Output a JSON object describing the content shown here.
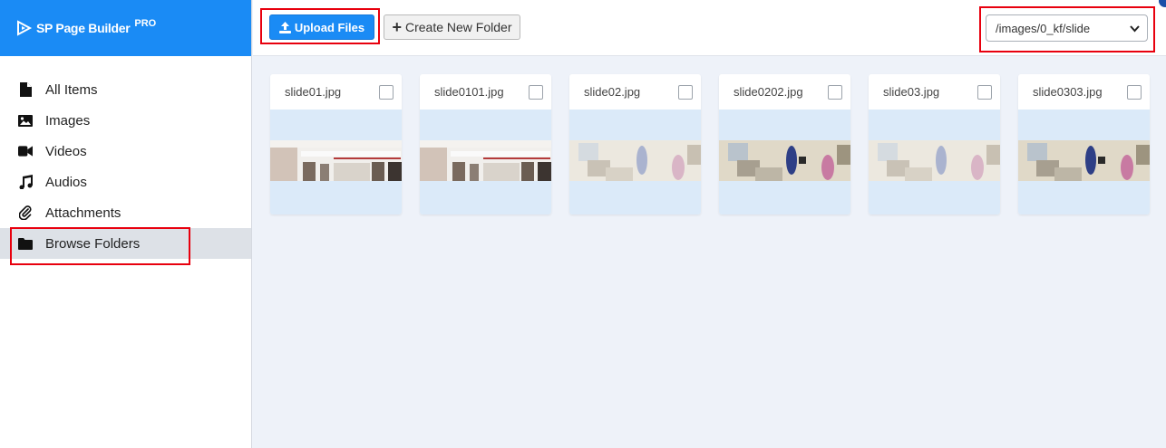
{
  "brand": {
    "name": "SP Page Builder",
    "badge": "PRO"
  },
  "sidebar": {
    "items": [
      {
        "label": "All Items",
        "icon": "file-icon"
      },
      {
        "label": "Images",
        "icon": "image-icon"
      },
      {
        "label": "Videos",
        "icon": "video-icon"
      },
      {
        "label": "Audios",
        "icon": "music-icon"
      },
      {
        "label": "Attachments",
        "icon": "paperclip-icon"
      },
      {
        "label": "Browse Folders",
        "icon": "folder-icon",
        "active": true
      }
    ]
  },
  "toolbar": {
    "upload_label": "Upload Files",
    "create_folder_label": "Create New Folder",
    "path_selected": "/images/0_kf/slide"
  },
  "files": [
    {
      "name": "slide01.jpg",
      "thumb": "building"
    },
    {
      "name": "slide0101.jpg",
      "thumb": "building"
    },
    {
      "name": "slide02.jpg",
      "thumb": "clinic"
    },
    {
      "name": "slide0202.jpg",
      "thumb": "clinic-color"
    },
    {
      "name": "slide03.jpg",
      "thumb": "clinic"
    },
    {
      "name": "slide0303.jpg",
      "thumb": "clinic-color"
    }
  ],
  "colors": {
    "brand": "#1a8bf5",
    "highlight": "#e8000e",
    "background": "#eef2f9"
  }
}
